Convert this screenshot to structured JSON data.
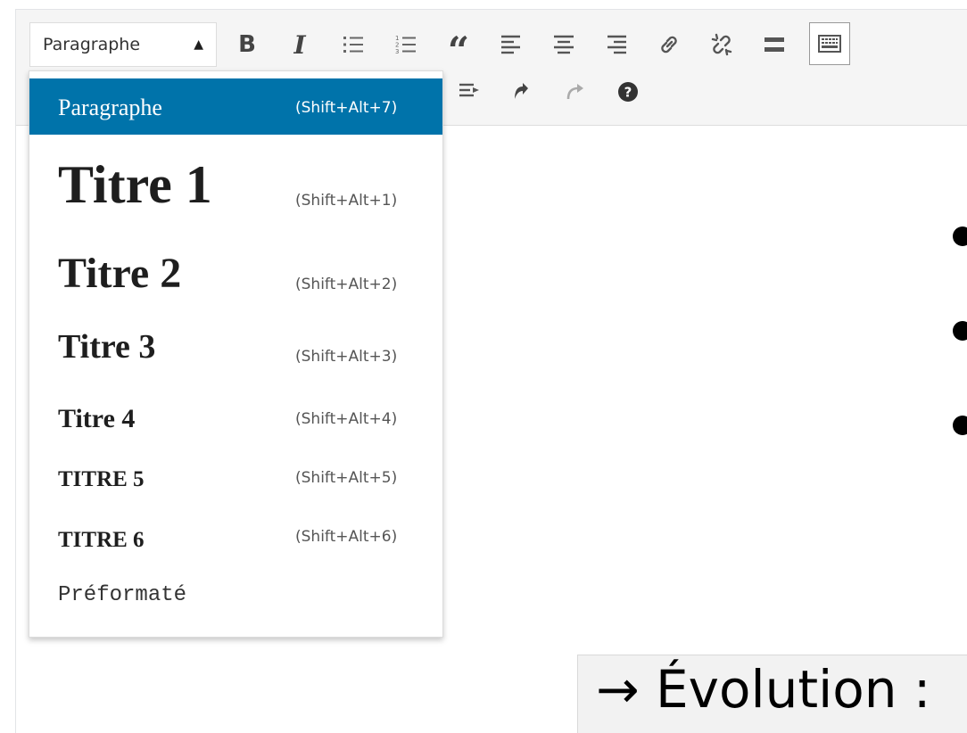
{
  "toolbar": {
    "format_value": "Paragraphe",
    "format_caret": "▲",
    "bold_label": "B",
    "italic_label": "I",
    "quote_label": "“"
  },
  "dropdown": {
    "items": [
      {
        "label": "Paragraphe",
        "shortcut": "(Shift+Alt+7)",
        "selected": true
      },
      {
        "label": "Titre 1",
        "shortcut": "(Shift+Alt+1)"
      },
      {
        "label": "Titre 2",
        "shortcut": "(Shift+Alt+2)"
      },
      {
        "label": "Titre 3",
        "shortcut": "(Shift+Alt+3)"
      },
      {
        "label": "Titre 4",
        "shortcut": "(Shift+Alt+4)"
      },
      {
        "label": "TITRE 5",
        "shortcut": "(Shift+Alt+5)"
      },
      {
        "label": "TITRE 6",
        "shortcut": "(Shift+Alt+6)"
      },
      {
        "label": "Préformaté",
        "shortcut": ""
      }
    ]
  },
  "slide": {
    "evolution_text": "→ Évolution :"
  },
  "colors": {
    "selected_bg": "#0073aa",
    "toolbar_bg": "#f5f5f5",
    "icon": "#444444",
    "redo_disabled": "#aaaaaa"
  },
  "icons": [
    "bold-icon",
    "italic-icon",
    "bullet-list-icon",
    "numbered-list-icon",
    "blockquote-icon",
    "align-left-icon",
    "align-center-icon",
    "align-right-icon",
    "link-icon",
    "unlink-icon",
    "read-more-icon",
    "toolbar-toggle-icon",
    "indent-icon",
    "undo-icon",
    "redo-icon",
    "help-icon"
  ]
}
